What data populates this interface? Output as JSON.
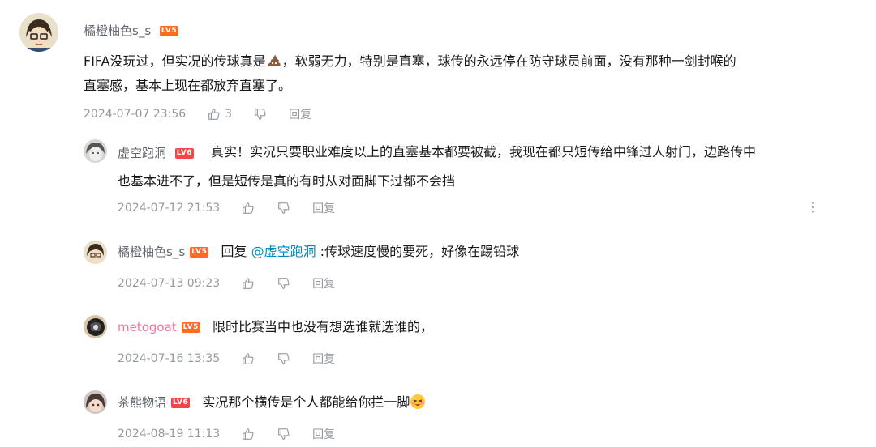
{
  "main_comment": {
    "username": "橘橙柚色s_s",
    "level": "LV5",
    "text_part1": "FIFA没玩过，但实况的传球真是",
    "emoji": "poop-emoji",
    "text_part2": "，软弱无力，特别是直塞，球传的永远停在防守球员前面，没有那种一剑封喉的",
    "text_line2": "直塞感，基本上现在都放弃直塞了。",
    "time": "2024-07-07 23:56",
    "like_count": "3",
    "reply_label": "回复"
  },
  "replies": [
    {
      "username": "虚空跑洞",
      "level": "LV6",
      "text_line1": "真实！实况只要职业难度以上的直塞基本都要被截，我现在都只短传给中锋过人射门，边路传中",
      "text_line2": "也基本进不了，但是短传是真的有时从对面脚下过都不会挡",
      "time": "2024-07-12 21:53",
      "reply_label": "回复",
      "more": "⋮"
    },
    {
      "username": "橘橙柚色s_s",
      "level": "LV5",
      "prefix": "回复",
      "mention": "@虚空跑洞",
      "text": " :传球速度慢的要死，好像在踢铅球",
      "time": "2024-07-13 09:23",
      "reply_label": "回复"
    },
    {
      "username": "metogoat",
      "level": "LV5",
      "text": "限时比赛当中也没有想选谁就选谁的，",
      "time": "2024-07-16 13:35",
      "reply_label": "回复"
    },
    {
      "username": "茶熊物语",
      "level": "LV6",
      "text": "实况那个横传是个人都能给你拦一脚",
      "emoji": "laughing-blush-emoji",
      "time": "2024-08-19 11:13",
      "reply_label": "回复"
    }
  ],
  "colors": {
    "lv5": "#ff6b22",
    "lv6": "#f54747",
    "vip_name": "#fb7299",
    "mention": "#008ac5",
    "meta": "#9499a0"
  }
}
